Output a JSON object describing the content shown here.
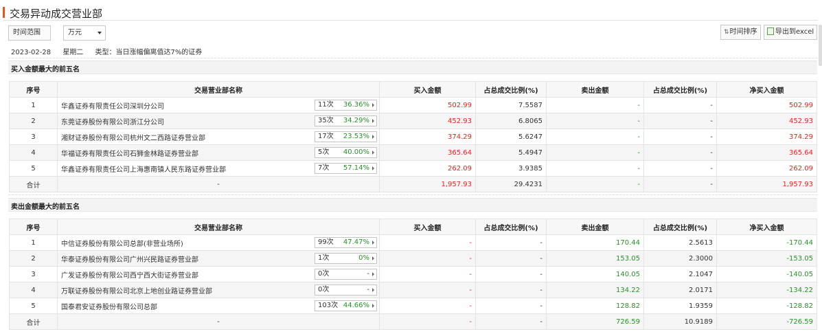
{
  "header": {
    "title": "交易异动成交营业部"
  },
  "toolbar": {
    "range_label": "时间范围",
    "unit_label": "万元",
    "sort_label": "时间排序",
    "export_label": "导出到excel"
  },
  "info": {
    "date": "2023-02-28",
    "weekday": "星期二",
    "type": "类型：当日涨幅偏离值达7%的证券"
  },
  "columns": {
    "seq": "序号",
    "name": "交易营业部名称",
    "buy": "买入金额",
    "buy_pct": "占总成交比例(%)",
    "sell": "卖出金额",
    "sell_pct": "占总成交比例(%)",
    "net": "净买入金额"
  },
  "buy_section": {
    "title": "买入金额最大的前五名",
    "rows": [
      {
        "seq": "1",
        "name": "华鑫证券有限责任公司深圳分公司",
        "count": "11次",
        "rate": "36.36%",
        "buy": "502.99",
        "buy_pct": "7.5587",
        "sell": "-",
        "sell_pct": "-",
        "net": "502.99"
      },
      {
        "seq": "2",
        "name": "东莞证券股份有限公司浙江分公司",
        "count": "35次",
        "rate": "34.29%",
        "buy": "452.93",
        "buy_pct": "6.8065",
        "sell": "-",
        "sell_pct": "-",
        "net": "452.93"
      },
      {
        "seq": "3",
        "name": "湘财证券股份有限公司杭州文二西路证券营业部",
        "count": "17次",
        "rate": "23.53%",
        "buy": "374.29",
        "buy_pct": "5.6247",
        "sell": "-",
        "sell_pct": "-",
        "net": "374.29"
      },
      {
        "seq": "4",
        "name": "华福证券有限责任公司石狮金林路证券营业部",
        "count": "5次",
        "rate": "40.00%",
        "buy": "365.64",
        "buy_pct": "5.4947",
        "sell": "-",
        "sell_pct": "-",
        "net": "365.64"
      },
      {
        "seq": "5",
        "name": "华鑫证券有限责任公司上海惠南镇人民东路证券营业部",
        "count": "7次",
        "rate": "57.14%",
        "buy": "262.09",
        "buy_pct": "3.9385",
        "sell": "-",
        "sell_pct": "-",
        "net": "262.09"
      }
    ],
    "total": {
      "label": "合计",
      "name": "-",
      "buy": "1,957.93",
      "buy_pct": "29.4231",
      "sell": "-",
      "sell_pct": "-",
      "net": "1,957.93"
    }
  },
  "sell_section": {
    "title": "卖出金额最大的前五名",
    "rows": [
      {
        "seq": "1",
        "name": "中信证券股份有限公司总部(非营业场所)",
        "count": "99次",
        "rate": "47.47%",
        "buy": "-",
        "buy_pct": "-",
        "sell": "170.44",
        "sell_pct": "2.5613",
        "net": "-170.44"
      },
      {
        "seq": "2",
        "name": "华泰证券股份有限公司广州兴民路证券营业部",
        "count": "1次",
        "rate": "0%",
        "buy": "-",
        "buy_pct": "-",
        "sell": "153.05",
        "sell_pct": "2.3000",
        "net": "-153.05"
      },
      {
        "seq": "3",
        "name": "广发证券股份有限公司西宁西大街证券营业部",
        "count": "0次",
        "rate": "-",
        "buy": "-",
        "buy_pct": "-",
        "sell": "140.05",
        "sell_pct": "2.1047",
        "net": "-140.05"
      },
      {
        "seq": "4",
        "name": "万联证券股份有限公司北京上地创业路证券营业部",
        "count": "0次",
        "rate": "-",
        "buy": "-",
        "buy_pct": "-",
        "sell": "134.22",
        "sell_pct": "2.0171",
        "net": "-134.22"
      },
      {
        "seq": "5",
        "name": "国泰君安证券股份有限公司总部",
        "count": "103次",
        "rate": "44.66%",
        "buy": "-",
        "buy_pct": "-",
        "sell": "128.82",
        "sell_pct": "1.9359",
        "net": "-128.82"
      }
    ],
    "total": {
      "label": "合计",
      "name": "-",
      "buy": "-",
      "buy_pct": "-",
      "sell": "726.59",
      "sell_pct": "10.9189",
      "net": "-726.59"
    }
  },
  "colors": {
    "accent": "#e5561a",
    "positive": "#e8221f",
    "negative": "#289028"
  }
}
